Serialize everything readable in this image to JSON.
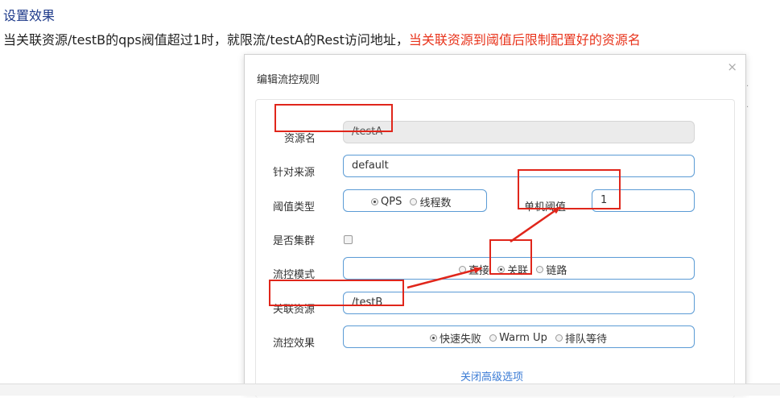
{
  "heading": "设置效果",
  "description": {
    "plain": "当关联资源/testB的qps阀值超过1时，就限流/testA的Rest访问地址，",
    "highlight": "当关联资源到阈值后限制配置好的资源名"
  },
  "dialog": {
    "title": "编辑流控规则",
    "close_symbol": "×",
    "resource": {
      "label": "资源名",
      "value": "/testA"
    },
    "limit_app": {
      "label": "针对来源",
      "value": "default"
    },
    "threshold_type": {
      "label": "阈值类型",
      "options": [
        "QPS",
        "线程数"
      ],
      "selected": "QPS"
    },
    "single_threshold": {
      "label": "单机阈值",
      "value": "1"
    },
    "cluster": {
      "label": "是否集群",
      "checked": false
    },
    "mode": {
      "label": "流控模式",
      "options": [
        "直接",
        "关联",
        "链路"
      ],
      "selected": "关联"
    },
    "ref_resource": {
      "label": "关联资源",
      "value": "/testB"
    },
    "effect": {
      "label": "流控效果",
      "options": [
        "快速失败",
        "Warm Up",
        "排队等待"
      ],
      "selected": "快速失败"
    },
    "advanced_link": "关闭高级选项"
  },
  "colors": {
    "annotation_red": "#e0261b",
    "input_border": "#5b9bd5",
    "link_blue": "#3a7bd5",
    "heading_blue": "#1e3a8a"
  }
}
